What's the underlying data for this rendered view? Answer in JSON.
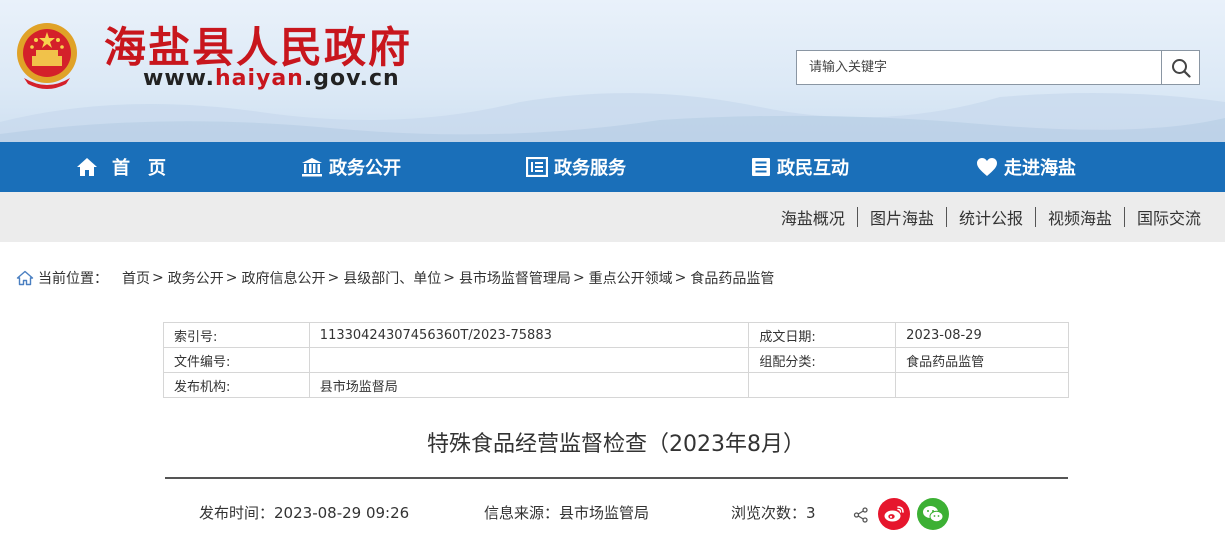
{
  "header": {
    "site_title": "海盐县人民政府",
    "url_prefix": "www.",
    "url_highlight": "haiyan",
    "url_suffix": ".gov.cn",
    "search_placeholder": "请输入关键字"
  },
  "main_nav": [
    {
      "label": "首　页",
      "icon": "home-icon"
    },
    {
      "label": "政务公开",
      "icon": "government-building-icon"
    },
    {
      "label": "政务服务",
      "icon": "service-list-icon"
    },
    {
      "label": "政民互动",
      "icon": "document-list-icon"
    },
    {
      "label": "走进海盐",
      "icon": "heart-icon"
    }
  ],
  "sub_nav": [
    "海盐概况",
    "图片海盐",
    "统计公报",
    "视频海盐",
    "国际交流"
  ],
  "breadcrumb": {
    "prefix": "当前位置：",
    "items": [
      "首页",
      "政务公开",
      "政府信息公开",
      "县级部门、单位",
      "县市场监督管理局",
      "重点公开领域",
      "食品药品监管"
    ],
    "separator": ">"
  },
  "info_table": {
    "rows": [
      [
        "索引号:",
        "11330424307456360T/2023-75883",
        "成文日期:",
        "2023-08-29"
      ],
      [
        "文件编号:",
        "",
        "组配分类:",
        "食品药品监管"
      ],
      [
        "发布机构:",
        "县市场监督局",
        "",
        ""
      ]
    ]
  },
  "article": {
    "title": "特殊食品经营监督检查（2023年8月）",
    "publish_time_label": "发布时间：",
    "publish_time": "2023-08-29 09:26",
    "source_label": "信息来源：",
    "source": "县市场监管局",
    "views_label": "浏览次数：",
    "views": "3"
  },
  "colors": {
    "brand_red": "#c8161d",
    "nav_blue": "#1a6fb9",
    "subnav_gray": "#ececec",
    "weibo_red": "#e6162d",
    "wechat_green": "#3cb034"
  }
}
